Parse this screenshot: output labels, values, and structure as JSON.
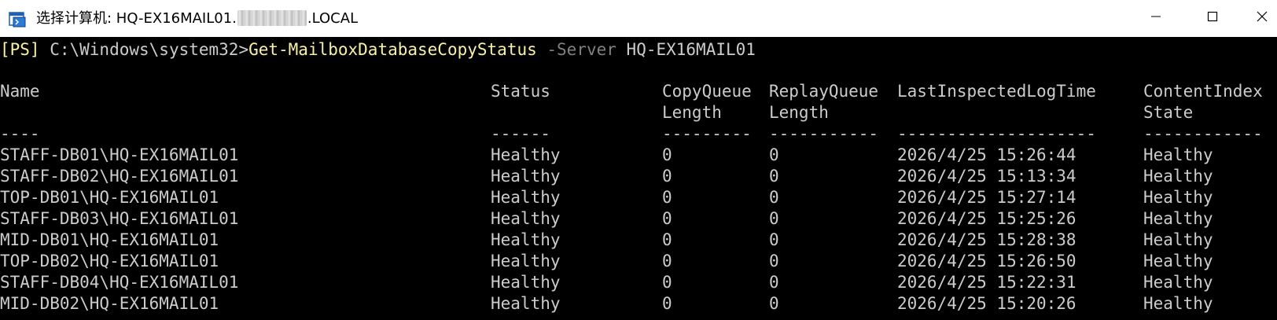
{
  "window": {
    "title_prefix": "选择计算机: HQ-EX16MAIL01.",
    "title_suffix": ".LOCAL",
    "icon": "powershell-window-icon",
    "controls": [
      "minimize-icon",
      "maximize-icon",
      "close-icon"
    ]
  },
  "prompt": {
    "tag": "[PS]",
    "path": " C:\\Windows\\system32>",
    "command": "Get-MailboxDatabaseCopyStatus",
    "parameter": " -Server",
    "argument": " HQ-EX16MAIL01"
  },
  "table": {
    "headers": {
      "line1": [
        "Name",
        "Status",
        "CopyQueue",
        "ReplayQueue",
        "LastInspectedLogTime",
        "ContentIndex"
      ],
      "line2": [
        "",
        "",
        "Length",
        "Length",
        "",
        "State"
      ],
      "separators": [
        "----",
        "------",
        "---------",
        "-----------",
        "--------------------",
        "------------"
      ]
    },
    "rows": [
      [
        "STAFF-DB01\\HQ-EX16MAIL01",
        "Healthy",
        "0",
        "0",
        "2026/4/25 15:26:44",
        "Healthy"
      ],
      [
        "STAFF-DB02\\HQ-EX16MAIL01",
        "Healthy",
        "0",
        "0",
        "2026/4/25 15:13:34",
        "Healthy"
      ],
      [
        "TOP-DB01\\HQ-EX16MAIL01",
        "Healthy",
        "0",
        "0",
        "2026/4/25 15:27:14",
        "Healthy"
      ],
      [
        "STAFF-DB03\\HQ-EX16MAIL01",
        "Healthy",
        "0",
        "0",
        "2026/4/25 15:25:26",
        "Healthy"
      ],
      [
        "MID-DB01\\HQ-EX16MAIL01",
        "Healthy",
        "0",
        "0",
        "2026/4/25 15:28:38",
        "Healthy"
      ],
      [
        "TOP-DB02\\HQ-EX16MAIL01",
        "Healthy",
        "0",
        "0",
        "2026/4/25 15:26:50",
        "Healthy"
      ],
      [
        "STAFF-DB04\\HQ-EX16MAIL01",
        "Healthy",
        "0",
        "0",
        "2026/4/25 15:22:31",
        "Healthy"
      ],
      [
        "MID-DB02\\HQ-EX16MAIL01",
        "Healthy",
        "0",
        "0",
        "2026/4/25 15:20:26",
        "Healthy"
      ]
    ]
  },
  "colors": {
    "console_bg": "#000000",
    "console_text": "#cccccc",
    "prompt_yellow": "#f9f1a5",
    "parameter_gray": "#808080",
    "titlebar_bg": "#ffffff"
  }
}
